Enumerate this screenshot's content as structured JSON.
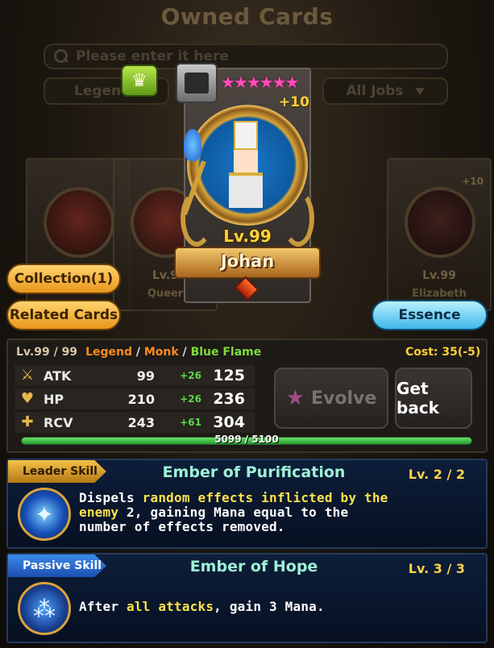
{
  "header": {
    "title": "Owned Cards",
    "search_placeholder": "Please enter it here",
    "rarity_filter": "Legend",
    "job_filter": "All Jobs"
  },
  "carousel": {
    "main_card": {
      "stars": "★★★★★★",
      "plus": "+10",
      "level": "Lv.99",
      "name": "Johan"
    },
    "side_cards": [
      {
        "level": "",
        "name": ""
      },
      {
        "level": "Lv.9",
        "name": "Queer"
      },
      {
        "level": "Lv.99",
        "name": "Elizabeth",
        "plus": "+10"
      }
    ]
  },
  "buttons": {
    "collection": "Collection(1)",
    "related": "Related Cards",
    "essence": "Essence",
    "evolve": "Evolve",
    "get_back": "Get back"
  },
  "card_info": {
    "level_text": "Lv.99 / 99",
    "rarity": "Legend",
    "sep1": " / ",
    "job": "Monk",
    "sep2": " / ",
    "element": "Blue Flame",
    "cost": "Cost: 35(-5)"
  },
  "stats": [
    {
      "label": "ATK",
      "base": "99",
      "bonus": "+26",
      "total": "125",
      "icon": "sword-icon"
    },
    {
      "label": "HP",
      "base": "210",
      "bonus": "+26",
      "total": "236",
      "icon": "heart-icon"
    },
    {
      "label": "RCV",
      "base": "243",
      "bonus": "+61",
      "total": "304",
      "icon": "cross-icon"
    }
  ],
  "experience": {
    "text": "5099 / 5100",
    "current": 5099,
    "max": 5100
  },
  "skills": {
    "leader": {
      "tag": "Leader Skill",
      "name": "Ember of Purification",
      "level": "Lv. 2 / 2",
      "desc_1": "Dispels ",
      "desc_hl_1": "random effects inflicted by the enemy",
      "desc_2": " 2, gaining Mana equal to the number of effects removed."
    },
    "passive": {
      "tag": "Passive Skill",
      "name": "Ember of Hope",
      "level": "Lv. 3 / 3",
      "desc_1": "After ",
      "desc_hl_1": "all attacks",
      "desc_2": ", gain 3 Mana."
    }
  },
  "colors": {
    "accent_gold": "#ffce3a",
    "rarity_orange": "#ff8a1e",
    "element_green": "#7ddc3a",
    "skill_title": "#9ef2d6"
  }
}
